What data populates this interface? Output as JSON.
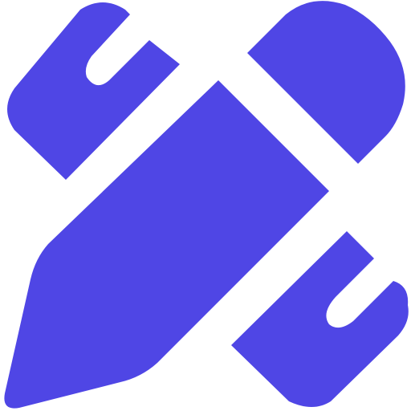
{
  "icon": {
    "name": "pencil-ruler-icon",
    "color": "#4f46e5",
    "background": "#ffffff"
  }
}
